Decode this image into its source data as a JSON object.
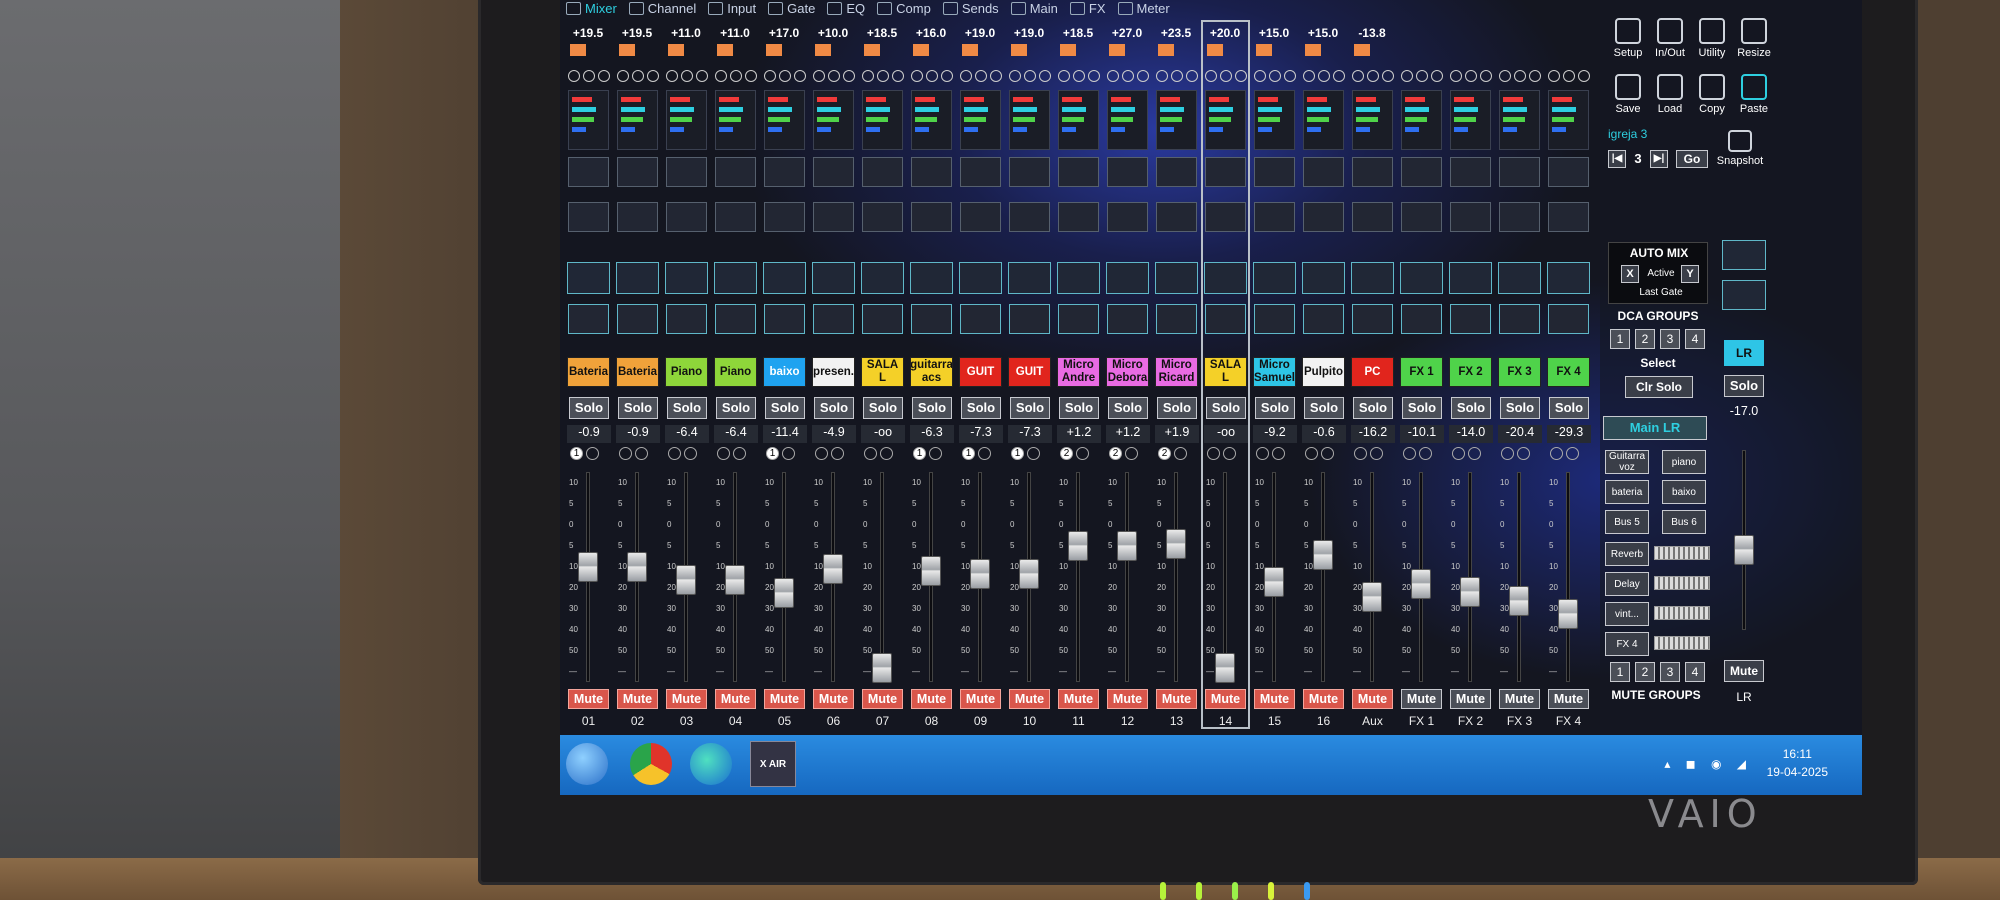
{
  "brand": "VAIO",
  "tabs": [
    "Mixer",
    "Channel",
    "Input",
    "Gate",
    "EQ",
    "Comp",
    "Sends",
    "Main",
    "FX",
    "Meter"
  ],
  "channels": [
    {
      "num": "01",
      "name": "Bateria",
      "color": "#f0a23a",
      "text": "#111",
      "peak": "+19.5",
      "gain": "-0.9",
      "fader": 0.58,
      "dca": [
        1,
        0
      ]
    },
    {
      "num": "02",
      "name": "Bateria",
      "color": "#f0a23a",
      "text": "#111",
      "peak": "+19.5",
      "gain": "-0.9",
      "fader": 0.58,
      "dca": [
        0,
        0
      ]
    },
    {
      "num": "03",
      "name": "Piano",
      "color": "#8ed63a",
      "text": "#111",
      "peak": "+11.0",
      "gain": "-6.4",
      "fader": 0.51,
      "dca": [
        0,
        0
      ]
    },
    {
      "num": "04",
      "name": "Piano",
      "color": "#8ed63a",
      "text": "#111",
      "peak": "+11.0",
      "gain": "-6.4",
      "fader": 0.51,
      "dca": [
        0,
        0
      ]
    },
    {
      "num": "05",
      "name": "baixo",
      "color": "#1fa3f0",
      "text": "#fff",
      "peak": "+17.0",
      "gain": "-11.4",
      "fader": 0.44,
      "dca": [
        1,
        0
      ]
    },
    {
      "num": "06",
      "name": "apresen...",
      "color": "#f2f2f2",
      "text": "#111",
      "peak": "+10.0",
      "gain": "-4.9",
      "fader": 0.57,
      "dca": [
        0,
        0
      ]
    },
    {
      "num": "07",
      "name": "SALA L",
      "color": "#f4d028",
      "text": "#111",
      "peak": "+18.5",
      "gain": "-oo",
      "fader": 0.05,
      "dca": [
        0,
        0
      ]
    },
    {
      "num": "08",
      "name": "guitarra acs",
      "color": "#f4d028",
      "text": "#111",
      "peak": "+16.0",
      "gain": "-6.3",
      "fader": 0.56,
      "dca": [
        1,
        0
      ]
    },
    {
      "num": "09",
      "name": "GUIT",
      "color": "#e1251d",
      "text": "#fff",
      "peak": "+19.0",
      "gain": "-7.3",
      "fader": 0.54,
      "dca": [
        1,
        0
      ]
    },
    {
      "num": "10",
      "name": "GUIT",
      "color": "#e1251d",
      "text": "#fff",
      "peak": "+19.0",
      "gain": "-7.3",
      "fader": 0.54,
      "dca": [
        1,
        0
      ]
    },
    {
      "num": "11",
      "name": "Micro Andre",
      "color": "#e96be3",
      "text": "#111",
      "peak": "+18.5",
      "gain": "+1.2",
      "fader": 0.69,
      "dca": [
        2,
        0
      ]
    },
    {
      "num": "12",
      "name": "Micro Debora",
      "color": "#e96be3",
      "text": "#111",
      "peak": "+27.0",
      "gain": "+1.2",
      "fader": 0.69,
      "dca": [
        2,
        0
      ]
    },
    {
      "num": "13",
      "name": "Micro Ricard",
      "color": "#e96be3",
      "text": "#111",
      "peak": "+23.5",
      "gain": "+1.9",
      "fader": 0.7,
      "dca": [
        2,
        0
      ]
    },
    {
      "num": "14",
      "name": "SALA L",
      "color": "#f4d028",
      "text": "#111",
      "peak": "+20.0",
      "gain": "-oo",
      "fader": 0.05,
      "dca": [
        0,
        0
      ]
    },
    {
      "num": "15",
      "name": "Micro Samuel",
      "color": "#2ec5e6",
      "text": "#111",
      "peak": "+15.0",
      "gain": "-9.2",
      "fader": 0.5,
      "dca": [
        0,
        0
      ]
    },
    {
      "num": "16",
      "name": "Pulpito",
      "color": "#f2f2f2",
      "text": "#111",
      "peak": "+15.0",
      "gain": "-0.6",
      "fader": 0.64,
      "dca": [
        0,
        0
      ]
    },
    {
      "num": "Aux",
      "name": "PC",
      "color": "#e1251d",
      "text": "#fff",
      "peak": "-13.8",
      "gain": "-16.2",
      "fader": 0.42,
      "dca": [
        0,
        0
      ]
    },
    {
      "num": "FX 1",
      "name": "FX 1",
      "color": "#4fd34a",
      "text": "#111",
      "peak": "",
      "gain": "-10.1",
      "fader": 0.49,
      "dca": [
        0,
        0
      ]
    },
    {
      "num": "FX 2",
      "name": "FX 2",
      "color": "#4fd34a",
      "text": "#111",
      "peak": "",
      "gain": "-14.0",
      "fader": 0.45,
      "dca": [
        0,
        0
      ]
    },
    {
      "num": "FX 3",
      "name": "FX 3",
      "color": "#4fd34a",
      "text": "#111",
      "peak": "",
      "gain": "-20.4",
      "fader": 0.4,
      "dca": [
        0,
        0
      ]
    },
    {
      "num": "FX 4",
      "name": "FX 4",
      "color": "#4fd34a",
      "text": "#111",
      "peak": "",
      "gain": "-29.3",
      "fader": 0.33,
      "dca": [
        0,
        0
      ]
    }
  ],
  "solo_label": "Solo",
  "mute_label": "Mute",
  "right": {
    "tools": [
      "Setup",
      "In/Out",
      "Utility",
      "Resize",
      "Save",
      "Load",
      "Copy",
      "Paste"
    ],
    "scene_name": "igreja 3",
    "scene_num": "3",
    "go": "Go",
    "snapshot": "Snapshot",
    "auto_mix": "AUTO MIX",
    "x": "X",
    "active": "Active",
    "y": "Y",
    "last_gate": "Last Gate",
    "dca_groups": "DCA GROUPS",
    "dca_nums": [
      "1",
      "2",
      "3",
      "4"
    ],
    "select": "Select",
    "clr_solo": "Clr Solo",
    "main_lr": "Main LR",
    "buses": [
      "Guitarra voz",
      "piano",
      "bateria",
      "baixo",
      "Bus 5",
      "Bus 6"
    ],
    "fx": [
      "Reverb",
      "Delay",
      "vint...",
      "FX 4"
    ],
    "mute_groups": "MUTE GROUPS",
    "mute_nums": [
      "1",
      "2",
      "3",
      "4"
    ],
    "lr_label": "LR",
    "lr_solo": "Solo",
    "lr_gain": "-17.0",
    "lr_fader": 0.47,
    "lr_mute": "Mute",
    "lr_num": "LR"
  },
  "taskbar": {
    "time": "16:11",
    "date": "19-04-2025",
    "xair": "X AIR"
  }
}
